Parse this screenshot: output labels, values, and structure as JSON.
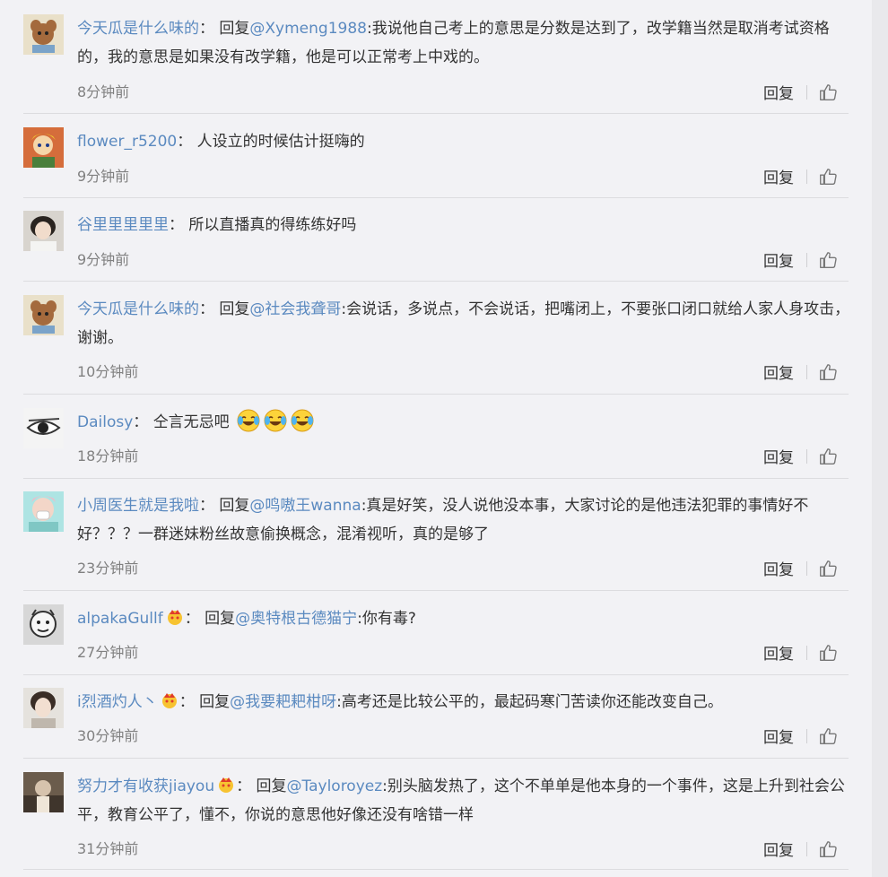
{
  "reply_label": "回复",
  "comments": [
    {
      "user": "今天瓜是什么味的",
      "reply_prefix": "回复",
      "mention": "@Xymeng1988",
      "text": ":我说他自己考上的意思是分数是达到了，改学籍当然是取消考试资格的，我的意思是如果没有改学籍，他是可以正常考上中戏的。",
      "time": "8分钟前"
    },
    {
      "user": "flower_r5200",
      "text": "人设立的时候估计挺嗨的",
      "time": "9分钟前"
    },
    {
      "user": "谷里里里里里",
      "text": "所以直播真的得练练好吗",
      "time": "9分钟前"
    },
    {
      "user": "今天瓜是什么味的",
      "reply_prefix": "回复",
      "mention": "@社会我聋哥",
      "text": ":会说话，多说点，不会说话，把嘴闭上，不要张口闭口就给人家人身攻击，谢谢。",
      "time": "10分钟前"
    },
    {
      "user": "Dailosy",
      "text": "仝言无忌吧",
      "emoji": "laugh-cry-emoji",
      "time": "18分钟前"
    },
    {
      "user": "小周医生就是我啦",
      "reply_prefix": "回复",
      "mention": "@鸣嗷王wanna",
      "text": ":真是好笑，没人说他没本事，大家讨论的是他违法犯罪的事情好不好？？？一群迷妹粉丝故意偷换概念，混淆视听，真的是够了",
      "time": "23分钟前"
    },
    {
      "user": "alpakaGullf",
      "badge": "crown-icon",
      "reply_prefix": "回复",
      "mention": "@奥特根古德猫宁",
      "text": ":你有毒?",
      "time": "27分钟前"
    },
    {
      "user": "i烈酒灼人丶",
      "badge": "crown-icon",
      "reply_prefix": "回复",
      "mention": "@我要耙耙柑呀",
      "text": ":高考还是比较公平的，最起码寒门苦读你还能改变自己。",
      "time": "30分钟前"
    },
    {
      "user": "努力才有收获jiayou",
      "badge": "crown-icon",
      "reply_prefix": "回复",
      "mention": "@Tayloroyez",
      "text": ":别头脑发热了，这个不单单是他本身的一个事件，这是上升到社会公平，教育公平了，懂不，你说的意思他好像还没有啥错一样",
      "time": "31分钟前"
    }
  ]
}
